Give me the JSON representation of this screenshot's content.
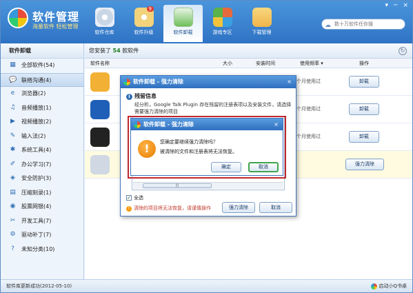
{
  "header": {
    "app_title": "软件管理",
    "slogan": "海量软件 轻松管理",
    "search_placeholder": "数十万软件任你搜",
    "window_buttons": [
      "▾",
      "─",
      "×"
    ],
    "nav": [
      {
        "label": "软件仓库",
        "icon": "cd-icon",
        "color": "#e8eef6"
      },
      {
        "label": "软件升级",
        "icon": "upgrade-disc-icon",
        "color": "#f2d27a",
        "badge": "9"
      },
      {
        "label": "软件卸载",
        "icon": "recycle-bin-icon",
        "color": "#6fbf5a"
      },
      {
        "label": "游戏专区",
        "icon": "game-tiles-icon",
        "color": "#e66a3c"
      },
      {
        "label": "下载管理",
        "icon": "download-folder-icon",
        "color": "#f0b54a"
      }
    ]
  },
  "sidebar": {
    "title": "软件卸载",
    "items": [
      {
        "label": "全部软件(54)",
        "icon": "▦"
      },
      {
        "label": "联络沟通(4)",
        "icon": "💬"
      },
      {
        "label": "浏览器(2)",
        "icon": "e"
      },
      {
        "label": "音频播放(1)",
        "icon": "♫"
      },
      {
        "label": "视频播放(2)",
        "icon": "▶"
      },
      {
        "label": "输入法(2)",
        "icon": "✎"
      },
      {
        "label": "系统工具(4)",
        "icon": "✱"
      },
      {
        "label": "办公学习(7)",
        "icon": "✐"
      },
      {
        "label": "安全防护(3)",
        "icon": "◈"
      },
      {
        "label": "压缩刻录(1)",
        "icon": "▤"
      },
      {
        "label": "股票网银(4)",
        "icon": "◉"
      },
      {
        "label": "开发工具(7)",
        "icon": "✂"
      },
      {
        "label": "驱动补丁(7)",
        "icon": "⚙"
      },
      {
        "label": "未知分类(10)",
        "icon": "?"
      }
    ],
    "active_index": 1
  },
  "main": {
    "count_prefix": "您安装了",
    "count_value": "54",
    "count_suffix": "款软件",
    "columns": [
      "软件名称",
      "大小",
      "安装时间",
      "使用频率 ▾",
      "操作"
    ],
    "rows": [
      {
        "usage": "一个月使用过",
        "action": "卸载",
        "icon_color": "#f2b134"
      },
      {
        "usage": "一个月使用过",
        "action": "卸载",
        "icon_color": "#1f5fb8"
      },
      {
        "usage": "一个月使用过",
        "action": "卸载",
        "icon_color": "#222222"
      },
      {
        "usage": "",
        "action": "强力清除",
        "icon_color": "#cfd8e3"
      }
    ]
  },
  "dialog": {
    "title": "软件卸载 - 强力清除",
    "section_title": "残留信息",
    "description": "经分析，Google Talk Plugin 存在残留的注册表项以及安装文件，请选择需要强力清除的项目",
    "scroll_thumb": "|||",
    "select_all": "全选",
    "warning": "清除的项目将无法恢复，请谨慎操作",
    "force_btn": "强力清除",
    "cancel_btn": "取消",
    "close": "×"
  },
  "confirm": {
    "title": "软件卸载 - 强力清除",
    "question": "您确定要继续强力清除吗？",
    "note": "被清除的文件和注册表将无法恢复。",
    "ok": "确定",
    "cancel": "取消",
    "close": "×",
    "warn_glyph": "!"
  },
  "statusbar": {
    "left": "软件库更新成功(2012-05-10)",
    "right": "启动小Q书桌"
  }
}
